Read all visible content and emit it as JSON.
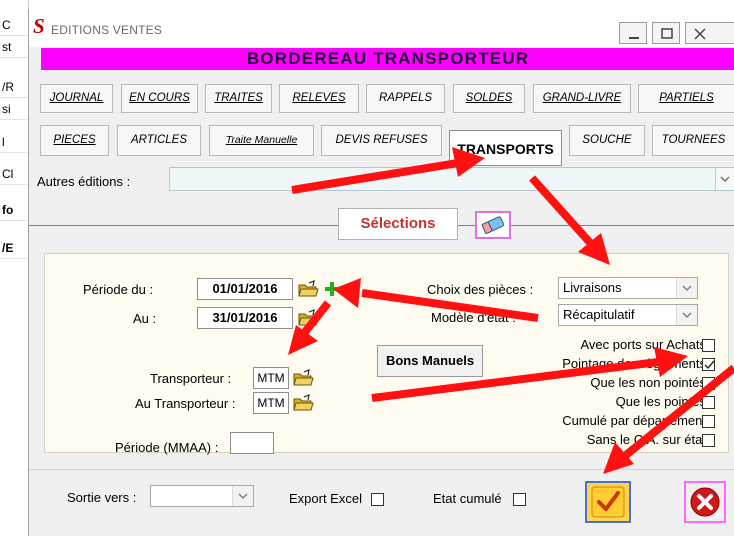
{
  "background_window": {
    "lines": [
      "C",
      "st",
      "/R",
      "si",
      "l",
      "Cl",
      "fo",
      "/E"
    ]
  },
  "window": {
    "app_logo": "S",
    "title": "EDITIONS VENTES",
    "header": "BORDEREAU TRANSPORTEUR",
    "title_buttons": [
      "minimize-icon",
      "maximize-icon",
      "close-icon"
    ]
  },
  "tabs_row1": [
    "JOURNAL",
    "EN COURS",
    "TRAITES",
    "RELEVES",
    "RAPPELS",
    "SOLDES",
    "GRAND-LIVRE",
    "PARTIELS"
  ],
  "tabs_row2": [
    "PIECES",
    "ARTICLES",
    "Traite Manuelle",
    "DEVIS REFUSES",
    "TRANSPORTS",
    "SOUCHE",
    "TOURNEES"
  ],
  "active_tab": "TRANSPORTS",
  "autres": {
    "label": "Autres éditions :",
    "value": ""
  },
  "selections": {
    "button_label": "Sélections",
    "icon": "eraser-icon"
  },
  "filters": {
    "periode_du_label": "Période du :",
    "periode_du_value": "01/01/2016",
    "au_label": "Au :",
    "au_value": "31/01/2016",
    "transporteur_label": "Transporteur :",
    "transporteur_value": "MTM",
    "au_transporteur_label": "Au Transporteur :",
    "au_transporteur_value": "MTM",
    "periode_mmaa_label": "Période (MMAA) :",
    "periode_mmaa_value": "",
    "choix_pieces_label": "Choix des pièces :",
    "choix_pieces_value": "Livraisons",
    "modele_etat_label": "Modèle d'état :",
    "modele_etat_value": "Récapitulatif",
    "bons_manuels_label": "Bons Manuels"
  },
  "checkboxes": [
    {
      "label": "Avec ports sur Achats",
      "checked": false
    },
    {
      "label": "Pointage des règlements",
      "checked": true
    },
    {
      "label": "Que les non pointés",
      "checked": false
    },
    {
      "label": "Que les pointés",
      "checked": false
    },
    {
      "label": "Cumulé par département",
      "checked": false
    },
    {
      "label": "Sans le C.A. sur état",
      "checked": false
    }
  ],
  "bottom": {
    "sortie_label": "Sortie vers :",
    "sortie_value": "",
    "export_excel_label": "Export Excel",
    "export_excel_checked": false,
    "etat_cumule_label": "Etat cumulé",
    "etat_cumule_checked": false
  },
  "colors": {
    "header_bg": "#ff00ff",
    "arrow": "#ff1111",
    "panel_bg": "#fffbee",
    "ok_bg": "#ffd34d"
  }
}
